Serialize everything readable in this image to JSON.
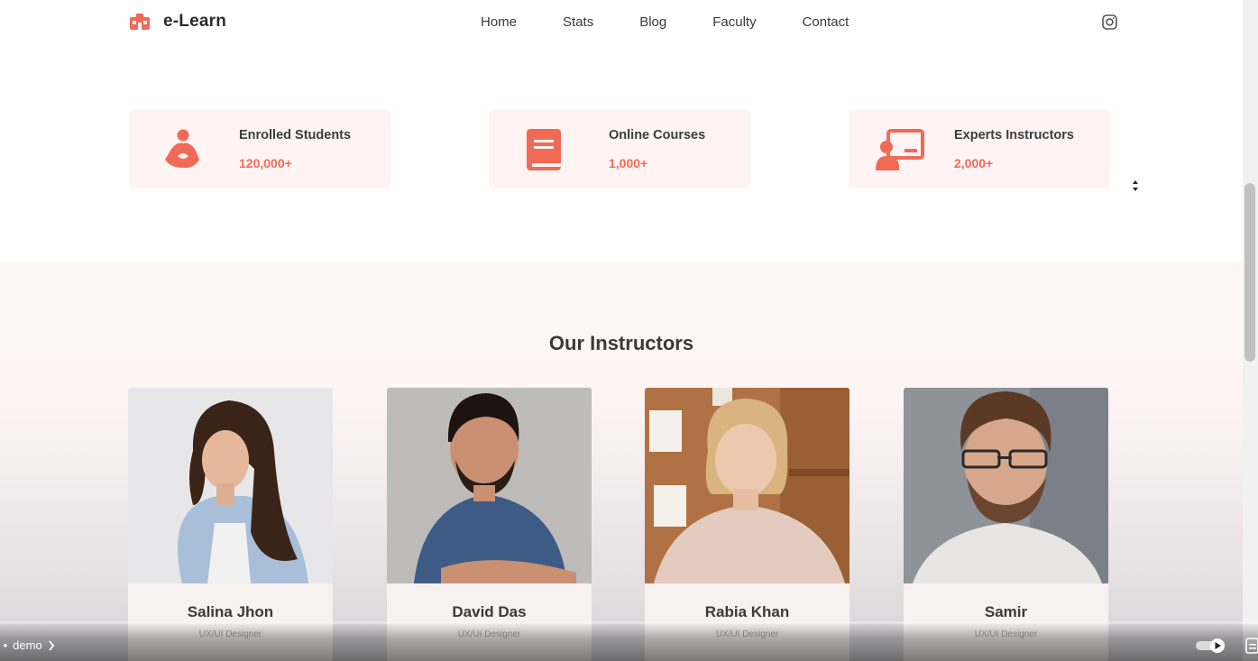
{
  "header": {
    "logo_text": "e-Learn",
    "nav": [
      "Home",
      "Stats",
      "Blog",
      "Faculty",
      "Contact"
    ],
    "social_icon": "instagram-icon"
  },
  "stats": [
    {
      "icon": "student-icon",
      "title": "Enrolled Students",
      "value": "120,000+"
    },
    {
      "icon": "book-icon",
      "title": "Online Courses",
      "value": "1,000+"
    },
    {
      "icon": "teacher-board-icon",
      "title": "Experts Instructors",
      "value": "2,000+"
    }
  ],
  "instructors": {
    "title": "Our Instructors",
    "people": [
      {
        "name": "Salina Jhon",
        "role": "UX/UI Designer"
      },
      {
        "name": "David Das",
        "role": "UX/UI Designer"
      },
      {
        "name": "Rabia Khan",
        "role": "UX/UI Designer"
      },
      {
        "name": "Samir",
        "role": "UX/UI Designer"
      }
    ]
  },
  "player": {
    "chapter_label": "demo"
  },
  "colors": {
    "accent": "#f06a56",
    "card_bg": "#fff3f3"
  }
}
